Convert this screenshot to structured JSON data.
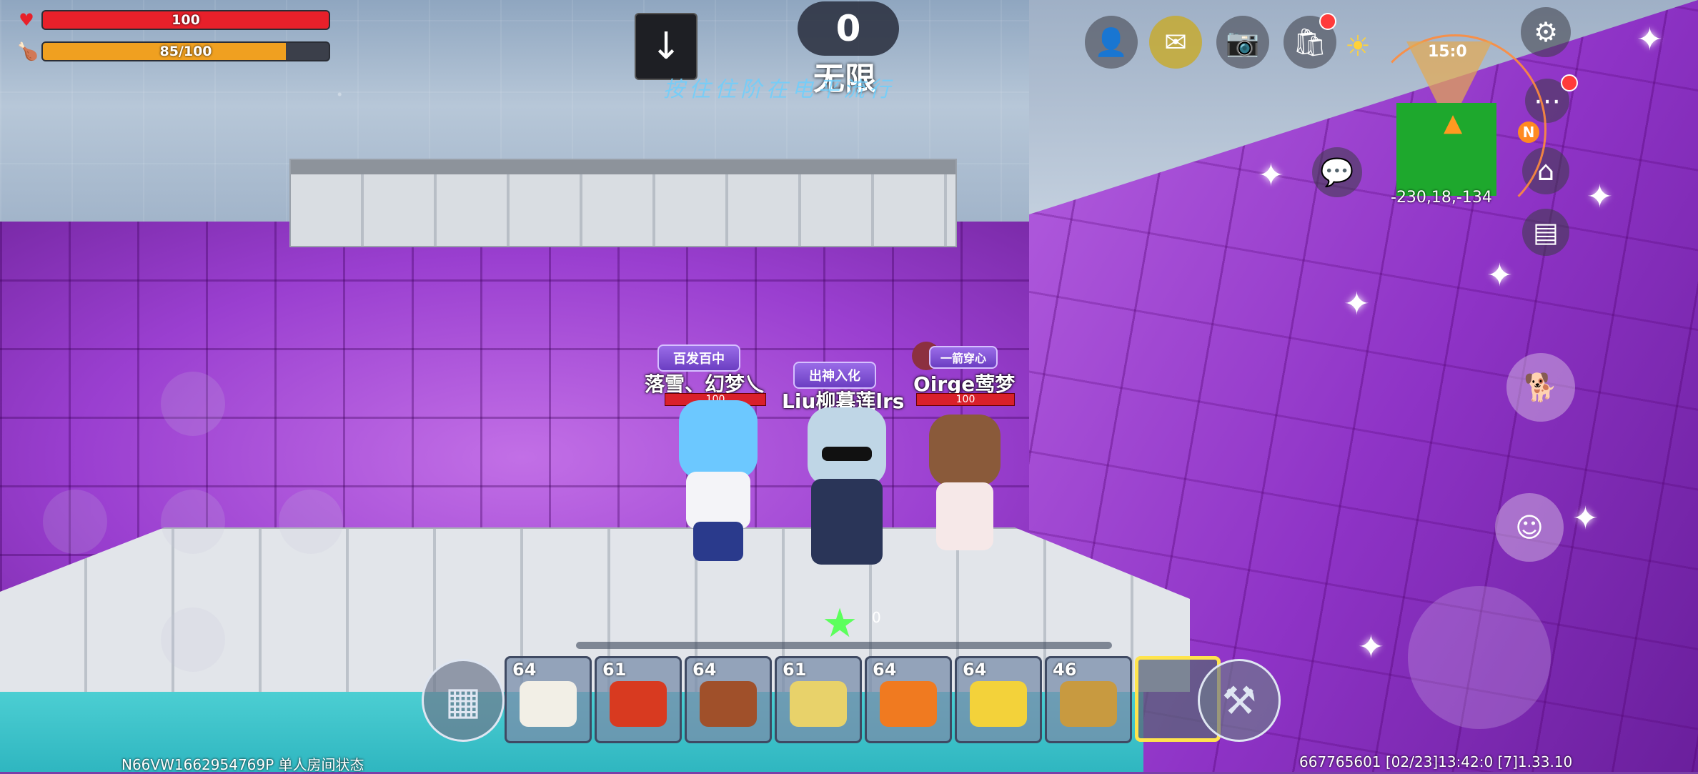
{
  "hud": {
    "health": {
      "value": 100,
      "text": "100",
      "fraction": 1.0,
      "color": "#e8202a"
    },
    "hunger": {
      "value": 85,
      "max": 100,
      "text": "85/100",
      "fraction": 0.85,
      "color": "#f0a020"
    },
    "score": "0",
    "mode": "无限",
    "compass_arrow": "↓",
    "hint": "按住住阶在电平流行"
  },
  "top_right": {
    "buttons": [
      {
        "name": "add-friend-button",
        "icon": "add-friend-icon",
        "glyph": "👤"
      },
      {
        "name": "mail-button",
        "icon": "mail-icon",
        "glyph": "✉"
      },
      {
        "name": "camera-button",
        "icon": "camera-icon",
        "glyph": "📷"
      },
      {
        "name": "shop-button",
        "icon": "shop-bag-icon",
        "glyph": "🛍"
      }
    ],
    "weather_icon": "sun-icon"
  },
  "minimap": {
    "time": "15:0",
    "coords": "-230,18,-134",
    "north": "N"
  },
  "side_buttons": {
    "chat": "chat-icon",
    "more": "more-icon",
    "home": "home-icon",
    "notebook": "notebook-icon",
    "pet": "pet-icon",
    "emote": "emote-icon"
  },
  "characters": [
    {
      "title": "百发百中",
      "name": "落雪、幻梦乀",
      "hp": "100"
    },
    {
      "title": "出神入化",
      "name": "Liu柳暮莲lrs",
      "hp": ""
    },
    {
      "title": "一箭穿心",
      "name": "Oirge莺梦",
      "hp": "100"
    }
  ],
  "star_counter": "0",
  "hotbar": {
    "slots": [
      {
        "count": "64",
        "item": "tofu",
        "color": "#f2efe6"
      },
      {
        "count": "61",
        "item": "roast-meat",
        "color": "#d83a20"
      },
      {
        "count": "64",
        "item": "steak",
        "color": "#a0502a"
      },
      {
        "count": "61",
        "item": "soup-bowl",
        "color": "#e8d26a"
      },
      {
        "count": "64",
        "item": "grilled-food",
        "color": "#f07a20"
      },
      {
        "count": "64",
        "item": "banana",
        "color": "#f3d23a"
      },
      {
        "count": "46",
        "item": "map-scroll",
        "color": "#c89a40"
      },
      {
        "count": "",
        "item": "empty",
        "color": ""
      }
    ]
  },
  "footer": {
    "left": "N66VW1662954769P 单人房间状态",
    "right": "667765601   [02/23]13:42:0   [7]1.33.10"
  }
}
